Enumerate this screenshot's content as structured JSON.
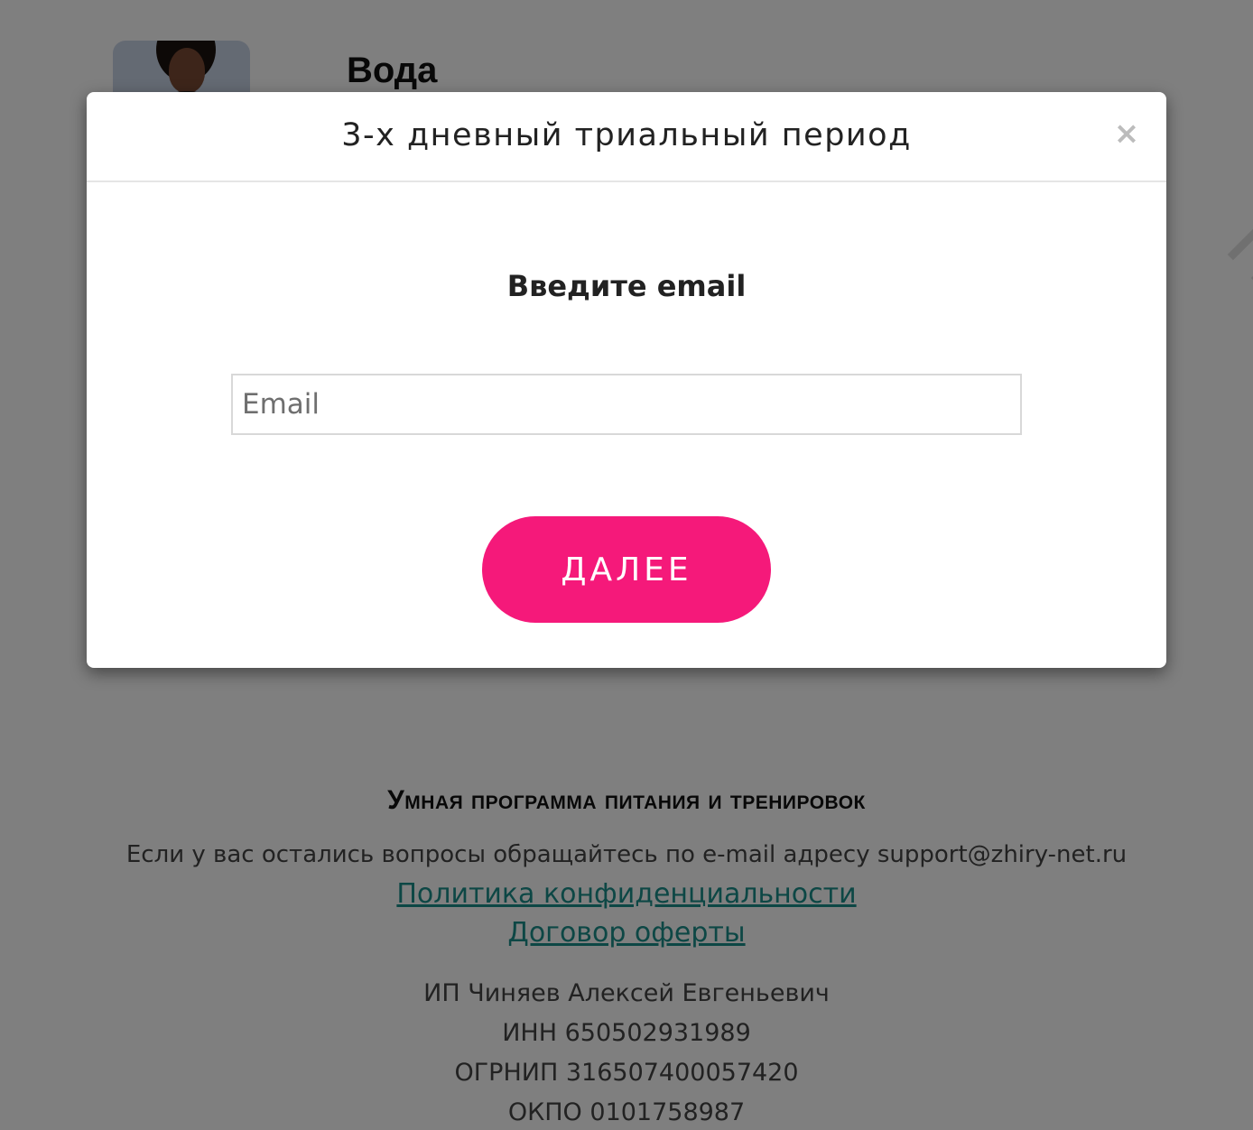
{
  "background": {
    "section_title": "Вода",
    "footer": {
      "title": "Умная программа питания и тренировок",
      "support_text": "Если у вас остались вопросы обращайтесь по e-mail адресу support@zhiry-net.ru",
      "links": [
        "Политика конфиденциальности",
        "Договор оферты"
      ],
      "legal": [
        "ИП Чиняев Алексей Евгеньевич",
        "ИНН 650502931989",
        "ОГРНИП 316507400057420",
        "ОКПО 0101758987"
      ]
    }
  },
  "modal": {
    "title": "3-х дневный триальный период",
    "close_symbol": "×",
    "heading": "Введите email",
    "email_placeholder": "Email",
    "email_value": "",
    "next_label": "ДАЛЕЕ"
  },
  "colors": {
    "accent": "#f5197a",
    "link": "#1b8f8a",
    "overlay": "rgba(0,0,0,0.5)"
  }
}
